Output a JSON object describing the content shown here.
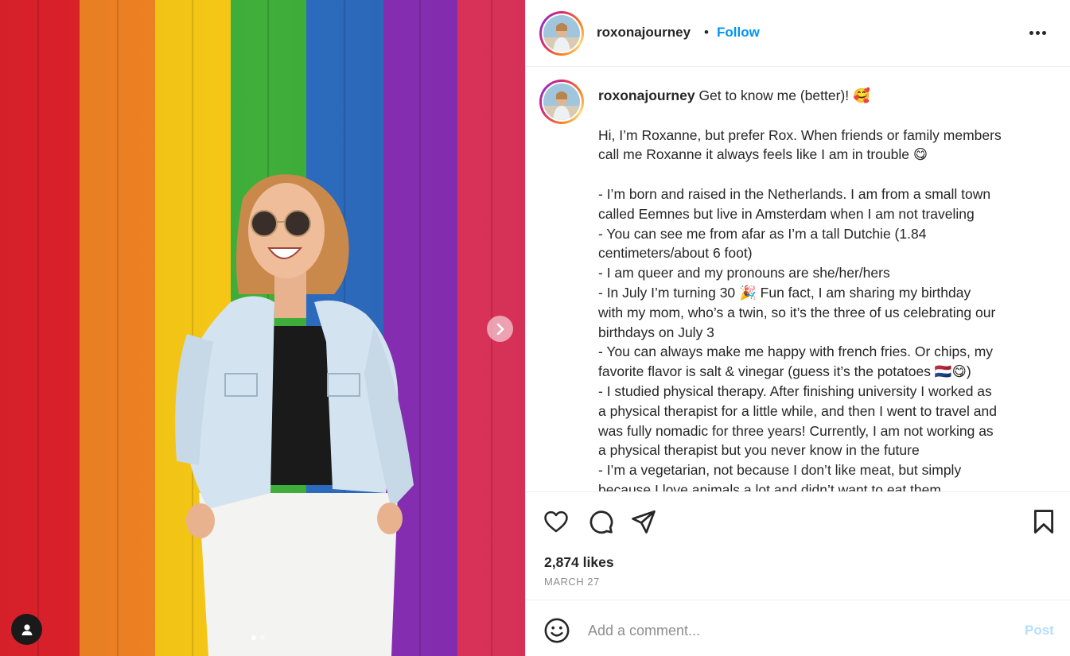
{
  "post": {
    "username": "roxonajourney",
    "follow_label": "Follow",
    "dot_separator": "•",
    "caption_lines": [
      "Get to know me (better)! 🥰",
      "",
      "Hi, I’m Roxanne, but prefer Rox. When friends or family members",
      "call me Roxanne it always feels like I am in trouble 😋",
      "",
      "- I’m born and raised in the Netherlands. I am from a small town",
      "called Eemnes but live in Amsterdam when I am not traveling",
      "- You can see me from afar as I’m a tall Dutchie (1.84",
      "centimeters/about 6 foot)",
      "- I am queer and my pronouns are she/her/hers",
      "- In July I’m turning 30 🎉 Fun fact, I am sharing my birthday",
      "with my mom, who’s a twin, so it’s the three of us celebrating our",
      "birthdays on July 3",
      "- You can always make me happy with french fries. Or chips, my",
      "favorite flavor is salt & vinegar (guess it’s the potatoes 🇳🇱😋)",
      "- I studied physical therapy. After finishing university I worked as",
      "a physical therapist for a little while, and then I went to travel and",
      "was fully nomadic for three years! Currently, I am not working as",
      "a physical therapist but you never know in the future",
      "- I’m a vegetarian, not because I don’t like meat, but simply",
      "because I love animals a lot and didn’t want to eat them"
    ],
    "likes": "2,874 likes",
    "date": "MARCH 27"
  },
  "comment": {
    "placeholder": "Add a comment...",
    "post_label": "Post"
  },
  "carousel": {
    "total": 2,
    "current": 1
  },
  "icons": {
    "like": "heart-icon",
    "comment": "comment-bubble-icon",
    "share": "paper-plane-icon",
    "save": "bookmark-icon",
    "more": "more-options-icon",
    "next": "chevron-right-icon",
    "tag": "user-tag-icon",
    "emoji": "smiley-icon"
  },
  "colors": {
    "accent": "#0095f6",
    "post_disabled": "#b2dffc",
    "muted": "#8e8e8e",
    "stripes": [
      "#e3222c",
      "#f28424",
      "#f7c815",
      "#3fae3a",
      "#2d6cc0",
      "#8a2fb8",
      "#e7355e"
    ]
  }
}
